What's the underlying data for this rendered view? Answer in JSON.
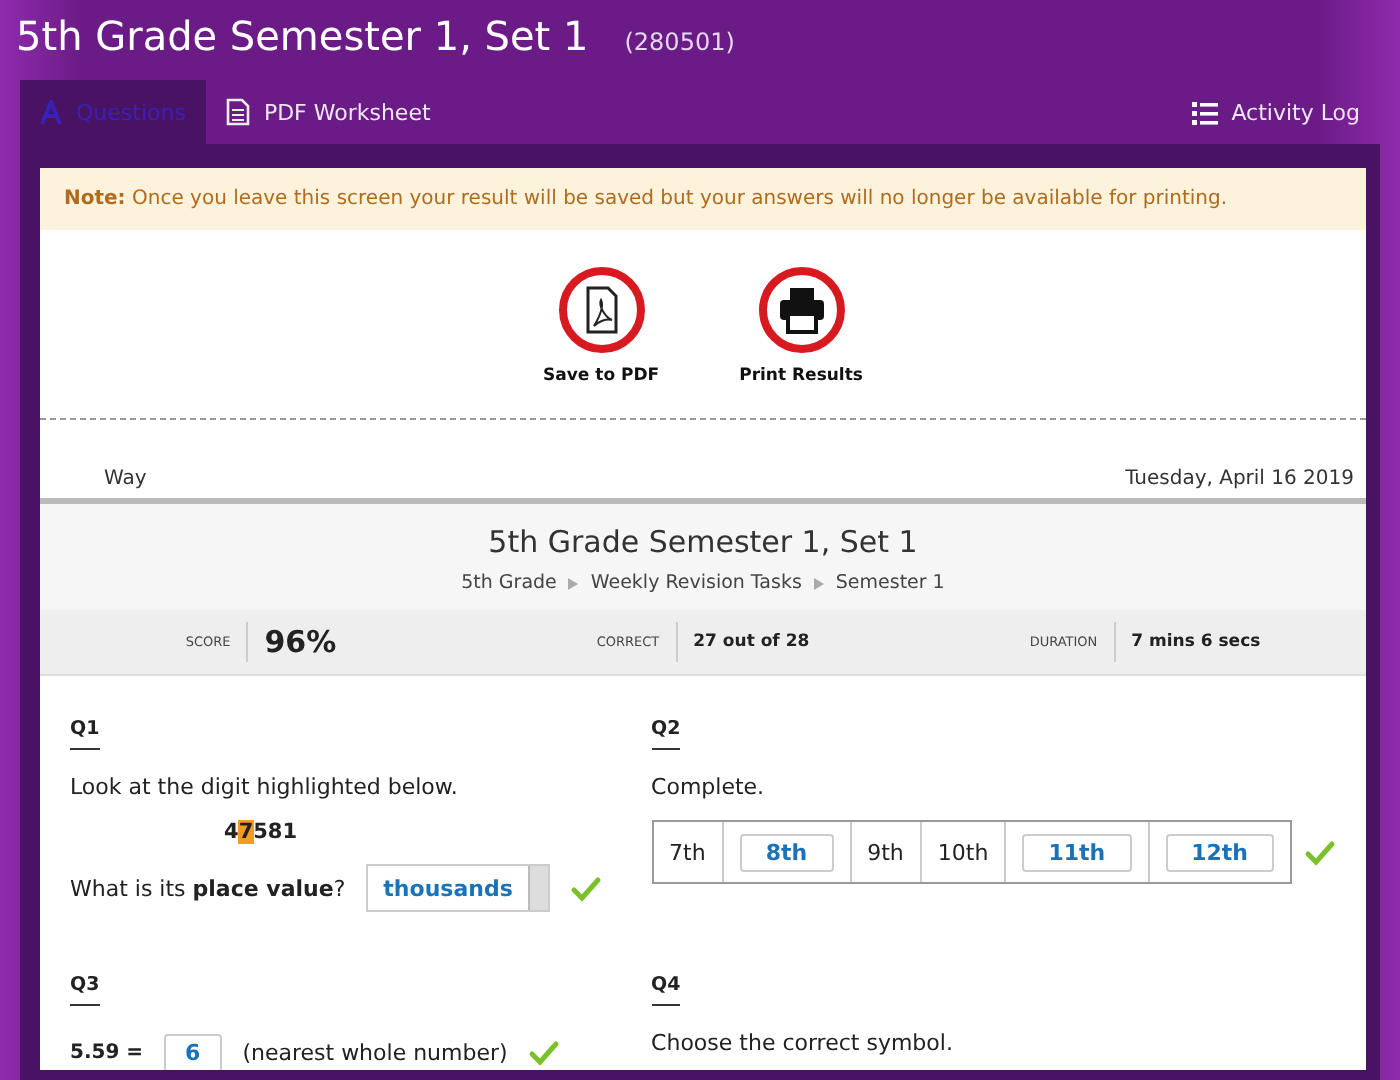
{
  "header": {
    "title": "5th Grade Semester 1, Set 1",
    "code": "(280501)"
  },
  "tabs": [
    {
      "label": "Questions",
      "kind": "letter",
      "selected": true
    },
    {
      "label": "PDF Worksheet",
      "kind": "document",
      "selected": false
    },
    {
      "label": "Activity Log",
      "kind": "list",
      "selected": false
    }
  ],
  "note": {
    "label": "Note:",
    "text": "Once you leave this screen your result will be saved but your answers will no longer be available for printing."
  },
  "actions": [
    {
      "label": "Save to PDF",
      "kind": "pdf"
    },
    {
      "label": "Print Results",
      "kind": "printer"
    }
  ],
  "print_header": {
    "left": "Way",
    "date": "Tuesday, April 16 2019"
  },
  "report": {
    "title": "5th Grade Semester 1, Set 1",
    "breadcrumb": [
      "5th Grade",
      "Weekly Revision Tasks",
      "Semester 1"
    ],
    "stats": [
      {
        "label": "SCORE",
        "value": "96%",
        "kind": "big"
      },
      {
        "label": "CORRECT",
        "value": "27 out of 28",
        "kind": "small"
      },
      {
        "label": "DURATION",
        "value": "7 mins 6 secs",
        "kind": "small"
      }
    ]
  },
  "questions": [
    {
      "kind": "digit",
      "number": "Q1",
      "prompt": "Look at the digit highlighted below.",
      "before": "4",
      "highlight": "7",
      "after": "581",
      "question": "What is its **place value**?",
      "answer": "thousands",
      "correct": true
    },
    {
      "kind": "sequence",
      "number": "Q2",
      "prompt": "Complete.",
      "cells": [
        {
          "text": "7th",
          "answer": false
        },
        {
          "text": "8th",
          "answer": true
        },
        {
          "text": "9th",
          "answer": false
        },
        {
          "text": "10th",
          "answer": false
        },
        {
          "text": "11th",
          "answer": true
        },
        {
          "text": "12th",
          "answer": true
        }
      ],
      "correct": true
    },
    {
      "kind": "rounding",
      "number": "Q3",
      "lhs": "5.59 =",
      "answer": "6",
      "suffix": "(nearest whole number)",
      "correct": true
    },
    {
      "kind": "choice",
      "number": "Q4",
      "prompt": "Choose the correct symbol."
    }
  ]
}
